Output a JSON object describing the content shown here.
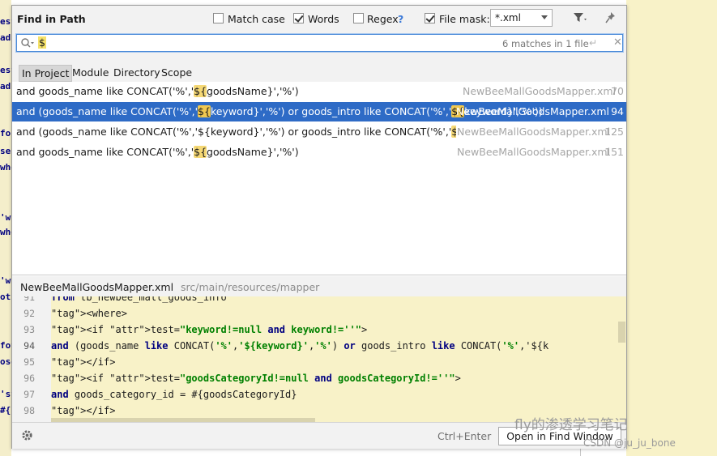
{
  "dialog": {
    "title": "Find in Path",
    "options": {
      "match_case": {
        "label": "Match case",
        "checked": false
      },
      "words": {
        "label": "Words",
        "checked": true
      },
      "regex": {
        "label": "Regex",
        "help": "?",
        "checked": false
      },
      "file_mask": {
        "label": "File mask:",
        "checked": true,
        "value": "*.xml"
      }
    },
    "search": {
      "query": "$",
      "match_count": "6 matches in 1 file"
    },
    "scopes": [
      "In Project",
      "Module",
      "Directory",
      "Scope"
    ],
    "selected_scope": "In Project",
    "results": [
      {
        "segments": [
          "and goods_name like CONCAT('%','",
          "${",
          "goodsName}','%')"
        ],
        "file": "NewBeeMallGoodsMapper.xml",
        "line": "70"
      },
      {
        "segments": [
          "and (goods_name like CONCAT('%','",
          "${",
          "keyword}','%') or goods_intro like CONCAT('%','",
          "${",
          "keyword}','%'))"
        ],
        "file": "NewBeeMallGoodsMapper.xml",
        "line": "94",
        "selected": true
      },
      {
        "segments": [
          "and (goods_name like CONCAT('%','${keyword}','%') or goods_intro like CONCAT('%','",
          "${",
          "keyword}','%'))"
        ],
        "file": "NewBeeMallGoodsMapper.xml",
        "line": "125"
      },
      {
        "segments": [
          "and goods_name like CONCAT('%','",
          "${",
          "goodsName}','%')"
        ],
        "file": "NewBeeMallGoodsMapper.xml",
        "line": "151"
      }
    ],
    "preview": {
      "file": "NewBeeMallGoodsMapper.xml",
      "path": "src/main/resources/mapper",
      "lines": [
        {
          "num": "91",
          "text": "        from tb_newbee_mall_goods_info"
        },
        {
          "num": "92",
          "text": "        <where>"
        },
        {
          "num": "93",
          "text": "            <if test=\"keyword!=null and keyword!=''\">"
        },
        {
          "num": "94",
          "text": "                and (goods_name like CONCAT('%','${keyword}','%') or goods_intro like CONCAT('%','${k"
        },
        {
          "num": "95",
          "text": "            </if>"
        },
        {
          "num": "96",
          "text": "            <if test=\"goodsCategoryId!=null and goodsCategoryId!=''\">"
        },
        {
          "num": "97",
          "text": "                and goods_category_id = #{goodsCategoryId}"
        },
        {
          "num": "98",
          "text": "            </if>"
        }
      ]
    },
    "footer": {
      "shortcut": "Ctrl+Enter",
      "open_button": "Open in Find Window"
    }
  },
  "background_editor": {
    "left_fragments": [
      "est",
      "ad",
      "est",
      "ad",
      "for",
      "se)",
      "whe",
      "'wh",
      "whe",
      "'wh",
      "oth",
      "fot",
      "ose",
      "'st",
      "#{"
    ]
  },
  "watermark": {
    "line1": "fly的渗透学习笔记",
    "line2": "CSDN @ju_ju_bone"
  },
  "colors": {
    "accent": "#2e6bc6",
    "highlight": "#f5d875",
    "preview_bg": "#f8f2c8"
  }
}
